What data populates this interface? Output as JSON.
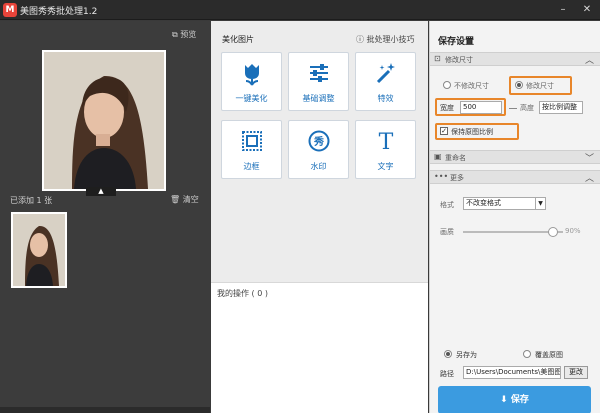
{
  "window": {
    "title": "美图秀秀批处理1.2",
    "logo": "M"
  },
  "left": {
    "preview_label": "预览",
    "collapse_arrow": "▲",
    "added_label": "已添加 1 张",
    "clear_label": "清空"
  },
  "middle": {
    "header": "美化图片",
    "tips_label": "批处理小技巧",
    "tools": [
      {
        "label": "一键美化",
        "icon": "tulip-icon"
      },
      {
        "label": "基础调整",
        "icon": "sliders-icon"
      },
      {
        "label": "特效",
        "icon": "magic-wand-icon"
      },
      {
        "label": "边框",
        "icon": "frame-icon"
      },
      {
        "label": "水印",
        "icon": "watermark-stamp-icon"
      },
      {
        "label": "文字",
        "icon": "text-T-icon"
      }
    ],
    "watermark_glyph": "秀",
    "text_glyph": "T",
    "ops_label": "我的操作 ( 0 )"
  },
  "right": {
    "title": "保存设置",
    "resize_section": "修改尺寸",
    "radio_keep": "不修改尺寸",
    "radio_modify": "修改尺寸",
    "width_label": "宽度",
    "width_value": "500",
    "height_label": "高度",
    "height_value": "按比例调整",
    "keep_ratio_label": "保持原图比例",
    "rename_section": "重命名",
    "more_section": "更多",
    "format_label": "格式",
    "format_value": "不改变格式",
    "quality_label": "画质",
    "quality_value": "90%",
    "quality": 90,
    "save_as_label": "另存为",
    "overwrite_label": "覆盖原图",
    "path_label": "路径",
    "path_value": "D:\\Users\\Documents\\美图图",
    "change_label": "更改",
    "save_label": "保存"
  },
  "colors": {
    "highlight": "#e8862a",
    "accent": "#3b9be0",
    "tool_text": "#1a6fb9"
  }
}
